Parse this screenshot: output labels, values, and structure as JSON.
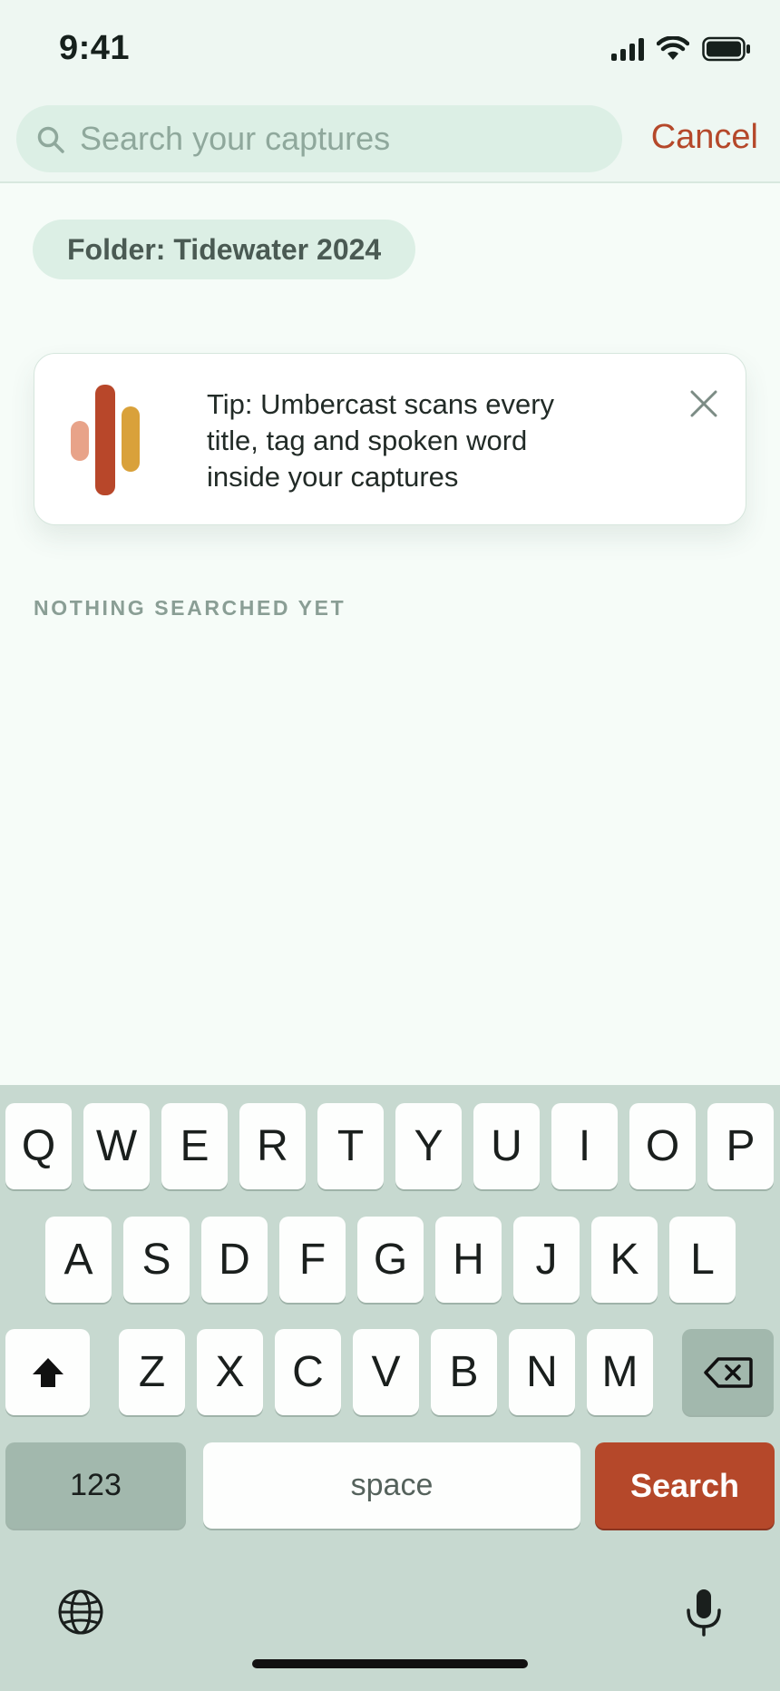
{
  "status_bar": {
    "time": "9:41",
    "icons": [
      "cellular-signal-icon",
      "wifi-icon",
      "battery-icon"
    ]
  },
  "search": {
    "placeholder": "Search your captures",
    "value": "",
    "cancel_label": "Cancel"
  },
  "filter_chip": {
    "label": "Folder: Tidewater 2024"
  },
  "tip": {
    "text": "Tip: Umbercast scans every title, tag and spoken word inside your captures",
    "logo": "umbercast-logo-icon",
    "colors": [
      "#e8a389",
      "#b8472a",
      "#d9a13a"
    ]
  },
  "section": {
    "label": "NOTHING SEARCHED YET"
  },
  "keyboard": {
    "row1": [
      "Q",
      "W",
      "E",
      "R",
      "T",
      "Y",
      "U",
      "I",
      "O",
      "P"
    ],
    "row2": [
      "A",
      "S",
      "D",
      "F",
      "G",
      "H",
      "J",
      "K",
      "L"
    ],
    "row3": [
      "Z",
      "X",
      "C",
      "V",
      "B",
      "N",
      "M"
    ],
    "numbers_label": "123",
    "space_label": "space",
    "action_label": "Search"
  },
  "colors": {
    "accent": "#b5482a",
    "background": "#f6fcf8",
    "keyboard": "#c7d9d0"
  }
}
